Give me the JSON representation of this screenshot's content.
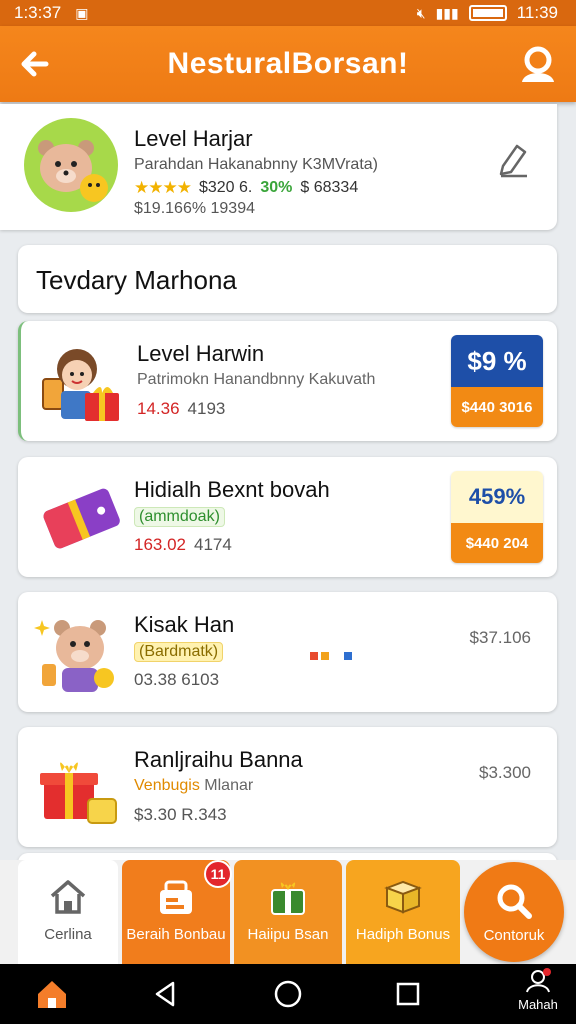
{
  "status_bar": {
    "time_left": "1:3:37",
    "time_right": "11:39"
  },
  "header": {
    "title": "NesturalBorsan!"
  },
  "profile_card": {
    "name": "Level Harjar",
    "subtitle": "Parahdan Hakanabnny K3MVrata)",
    "stars": "★★★★",
    "stat1": "$320 6.",
    "stat_green": "30%",
    "stat2": "$ 68334",
    "footer": "$19.166% 19394"
  },
  "section": {
    "title": "Tevdary Marhona"
  },
  "items": [
    {
      "name": "Level Harwin",
      "subtitle": "Patrimokn Hanandbnny Kakuvath",
      "price_red": "14.36",
      "price": "4193",
      "badge_top": "$9 %",
      "badge_bottom": "$440 3016"
    },
    {
      "name": "Hidialh Bexnt bovah",
      "tag": "(ammdoak)",
      "price_red": "163.02",
      "price": "4174",
      "badge_top": "459%",
      "badge_bottom": "$440 204"
    },
    {
      "name": "Kisak Han",
      "tag": "(Bardmatk)",
      "price": "03.38 6103",
      "right_price": "$37.106"
    },
    {
      "name": "Ranljraihu Banna",
      "tag": "Venbugis",
      "tag_extra": "Mlanar",
      "price": "$3.30 R.343",
      "right_price": "$3.300"
    }
  ],
  "bottom_nav": [
    {
      "label": "Cerlina",
      "icon": "home-outline-icon"
    },
    {
      "label": "Beraih Bonbau",
      "icon": "gift-box-icon",
      "badge": "11"
    },
    {
      "label": "Haiipu Bsan",
      "icon": "gift-icon"
    },
    {
      "label": "Hadiph Bonus",
      "icon": "box-icon"
    },
    {
      "label": "Contoruk",
      "icon": "search-icon"
    }
  ],
  "system_nav": {
    "account_label": "Mahah"
  },
  "colors": {
    "primary": "#f07a15",
    "badge_blue": "#1e4fa8",
    "alert_red": "#e3262c"
  }
}
